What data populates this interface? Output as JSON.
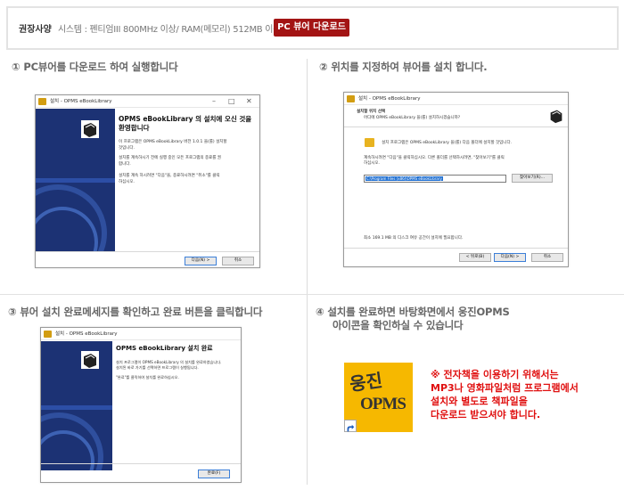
{
  "requirements": {
    "label": "권장사양",
    "text": "시스템 : 펜티엄III 800MHz 이상/ RAM(메모리) 512MB 이상",
    "download_button": "PC 뷰어 다운로드"
  },
  "steps": [
    {
      "title": "① PC뷰어를 다운로드 하여 실행합니다"
    },
    {
      "title": "② 위치를 지정하여 뷰어를 설치 합니다."
    },
    {
      "title": "③ 뷰어 설치 완료메세지를 확인하고 완료 버튼을 클릭합니다"
    },
    {
      "title_line1": "④ 설치를 완료하면 바탕화면에서 웅진OPMS",
      "title_line2": "아이콘을 확인하실 수 있습니다"
    }
  ],
  "window1": {
    "title": "설치 - OPMS eBookLibrary",
    "heading_line1": "OPMS eBookLibrary 의 설치에 오신 것을",
    "heading_line2": "환영합니다",
    "body1_line1": "이 프로그램은 OPMS eBookLibrary 버전 1.0.1 을(를) 설치할",
    "body1_line2": "것입니다.",
    "body2_line1": "설치를 계속하시기 전에 실행 중인 모든 프로그램의 종료를 권",
    "body2_line2": "합니다.",
    "body3_line1": "설치를 계속 하시려면 \"다음\"을, 종료하시려면 \"취소\"를 클릭",
    "body3_line2": "하십시오.",
    "next_button": "다음(N) >",
    "cancel_button": "취소"
  },
  "window2": {
    "title": "설치 - OPMS eBookLibrary",
    "header_title": "설치할 위치 선택",
    "header_sub": "어디에 OPMS eBookLibrary 을(를) 설치하시겠습니까?",
    "folder_text": "설치 프로그램은 OPMS eBookLibrary 을(를) 다음 폴더에 설치할 것입니다.",
    "continue_line1": "계속하시려면 \"다음\"을 클릭하십시오. 다른 폴더를 선택하시려면, \"찾아보기\"를 클릭",
    "continue_line2": "하십시오.",
    "path": "C:\\Program Files (x86)\\OPMS eBookLibrary",
    "browse_button": "찾아보기(R)...",
    "space_text": "최소 169.1 MB 의 디스크 여유 공간이 설치에 필요합니다.",
    "back_button": "< 뒤로(B)",
    "next_button": "다음(N) >",
    "cancel_button": "취소"
  },
  "window3": {
    "title": "설치 - OPMS eBookLibrary",
    "heading": "OPMS eBookLibrary 설치 완료",
    "body1_line1": "설치 프로그램이 OPMS eBookLibrary 의 설치를 완료하였습니다.",
    "body1_line2": "설치된 바로 가기를 선택하면 프로그램이 실행됩니다.",
    "body2": "\"완료\"를 클릭하여 설치를 완료하십시오.",
    "finish_button": "완료(F)"
  },
  "desktop_icon": {
    "text_top": "웅진",
    "text_bottom": "OPMS"
  },
  "warning": {
    "line1": "※ 전자책을 이용하기 위해서는",
    "line2": "MP3나 영화파일처럼 프로그램에서",
    "line3": "설치와 별도로 책파일을",
    "line4": "다운로드 받으셔야 합니다."
  },
  "colors": {
    "download_button": "#a31414",
    "warning_text": "#e01010",
    "side_panel": "#1c3274",
    "icon_background": "#f6b800"
  },
  "icons": [
    "installer-app-icon",
    "ebook-library-icon",
    "folder-icon",
    "shortcut-arrow-icon"
  ]
}
